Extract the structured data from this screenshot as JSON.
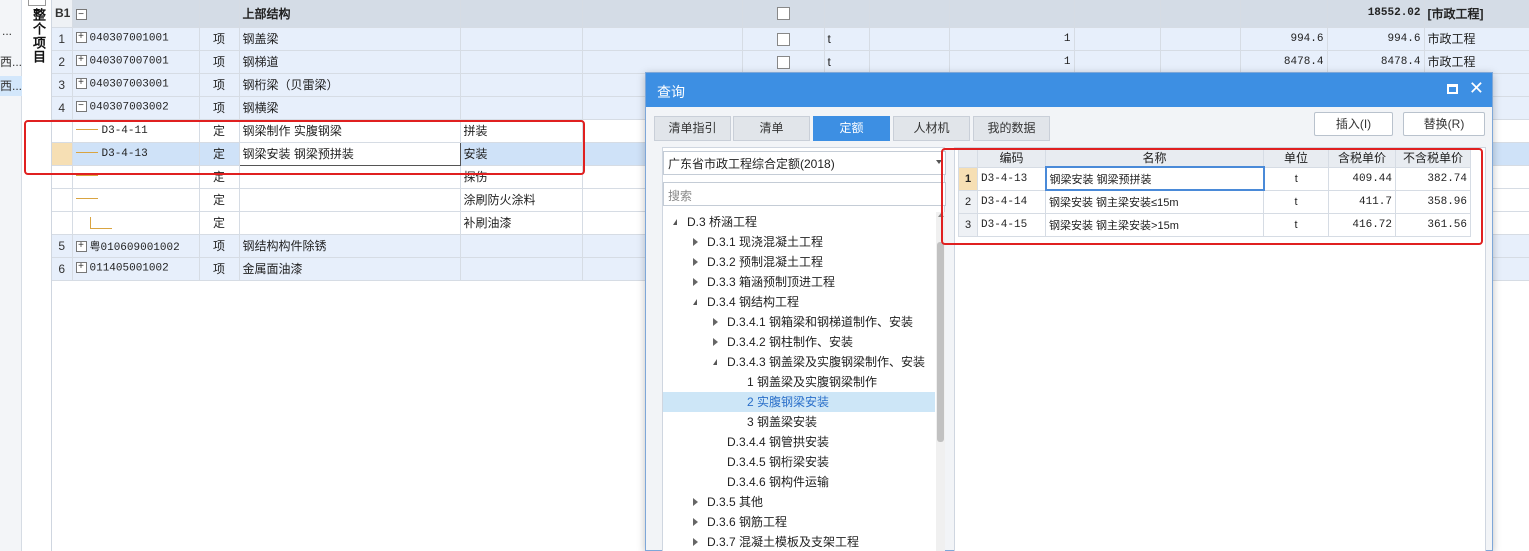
{
  "left_strip": {
    "more": "...",
    "items": [
      "西...",
      "西..."
    ],
    "vertical_tab": "整个项目"
  },
  "grid": {
    "header_row": {
      "num": "B1",
      "name": "上部结构",
      "total": "18552.02",
      "specialty": "[市政工程]"
    },
    "rows": [
      {
        "num": "1",
        "code": "040307001001",
        "type": "项",
        "name": "钢盖梁",
        "unit": "t",
        "qty": "1",
        "price": "994.6",
        "total": "994.6",
        "specialty": "市政工程"
      },
      {
        "num": "2",
        "code": "040307007001",
        "type": "项",
        "name": "钢梯道",
        "unit": "t",
        "qty": "1",
        "price": "8478.4",
        "total": "8478.4",
        "specialty": "市政工程"
      },
      {
        "num": "3",
        "code": "040307003001",
        "type": "项",
        "name": "钢桁梁（贝雷梁）"
      },
      {
        "num": "4",
        "code": "040307003002",
        "type": "项",
        "name": "钢横梁"
      },
      {
        "code": "D3-4-11",
        "type": "定",
        "name": "钢梁制作 实腹钢梁",
        "feature": "拼装"
      },
      {
        "code": "D3-4-13",
        "type": "定",
        "name": "钢梁安装 钢梁预拼装",
        "feature": "安装"
      },
      {
        "code": "",
        "type": "定",
        "name": "",
        "feature": "探伤"
      },
      {
        "code": "",
        "type": "定",
        "name": "",
        "feature": "涂刷防火涂料"
      },
      {
        "code": "",
        "type": "定",
        "name": "",
        "feature": "补刷油漆"
      },
      {
        "num": "5",
        "code": "粤010609001002",
        "type": "项",
        "name": "钢结构构件除锈"
      },
      {
        "num": "6",
        "code": "011405001002",
        "type": "项",
        "name": "金属面油漆"
      }
    ]
  },
  "dialog": {
    "title": "查询",
    "tabs": [
      "清单指引",
      "清单",
      "定额",
      "人材机",
      "我的数据"
    ],
    "active_tab": "定额",
    "insert_button": "插入(I)",
    "replace_button": "替换(R)",
    "library": "广东省市政工程综合定额(2018)",
    "search_placeholder": "搜索",
    "tree": [
      {
        "label": "D.3 桥涵工程",
        "level": 0,
        "state": "open"
      },
      {
        "label": "D.3.1 现浇混凝土工程",
        "level": 1,
        "state": "closed"
      },
      {
        "label": "D.3.2 预制混凝土工程",
        "level": 1,
        "state": "closed"
      },
      {
        "label": "D.3.3 箱涵预制顶进工程",
        "level": 1,
        "state": "closed"
      },
      {
        "label": "D.3.4 钢结构工程",
        "level": 1,
        "state": "open"
      },
      {
        "label": "D.3.4.1 钢箱梁和钢梯道制作、安装",
        "level": 2,
        "state": "closed"
      },
      {
        "label": "D.3.4.2 钢柱制作、安装",
        "level": 2,
        "state": "closed"
      },
      {
        "label": "D.3.4.3 钢盖梁及实腹钢梁制作、安装",
        "level": 2,
        "state": "open"
      },
      {
        "label": "1 钢盖梁及实腹钢梁制作",
        "level": 3,
        "state": "leaf"
      },
      {
        "label": "2 实腹钢梁安装",
        "level": 3,
        "state": "leaf",
        "selected": true
      },
      {
        "label": "3 钢盖梁安装",
        "level": 3,
        "state": "leaf"
      },
      {
        "label": "D.3.4.4 钢管拱安装",
        "level": 2,
        "state": "leaf"
      },
      {
        "label": "D.3.4.5 钢桁梁安装",
        "level": 2,
        "state": "leaf"
      },
      {
        "label": "D.3.4.6 钢构件运输",
        "level": 2,
        "state": "leaf"
      },
      {
        "label": "D.3.5 其他",
        "level": 1,
        "state": "closed"
      },
      {
        "label": "D.3.6 钢筋工程",
        "level": 1,
        "state": "closed"
      },
      {
        "label": "D.3.7 混凝土模板及支架工程",
        "level": 1,
        "state": "closed"
      }
    ],
    "result_headers": [
      "编码",
      "名称",
      "单位",
      "含税单价",
      "不含税单价"
    ],
    "results": [
      {
        "num": "1",
        "code": "D3-4-13",
        "name": "钢梁安装 钢梁预拼装",
        "unit": "t",
        "price_tax": "409.44",
        "price_notax": "382.74"
      },
      {
        "num": "2",
        "code": "D3-4-14",
        "name": "钢梁安装 钢主梁安装≤15m",
        "unit": "t",
        "price_tax": "411.7",
        "price_notax": "358.96"
      },
      {
        "num": "3",
        "code": "D3-4-15",
        "name": "钢梁安装 钢主梁安装>15m",
        "unit": "t",
        "price_tax": "416.72",
        "price_notax": "361.56"
      }
    ]
  },
  "colors": {
    "accent": "#3d8fe3",
    "annotation": "#e02020",
    "row_blue": "#e7effb",
    "selected": "#cfe2f8"
  }
}
